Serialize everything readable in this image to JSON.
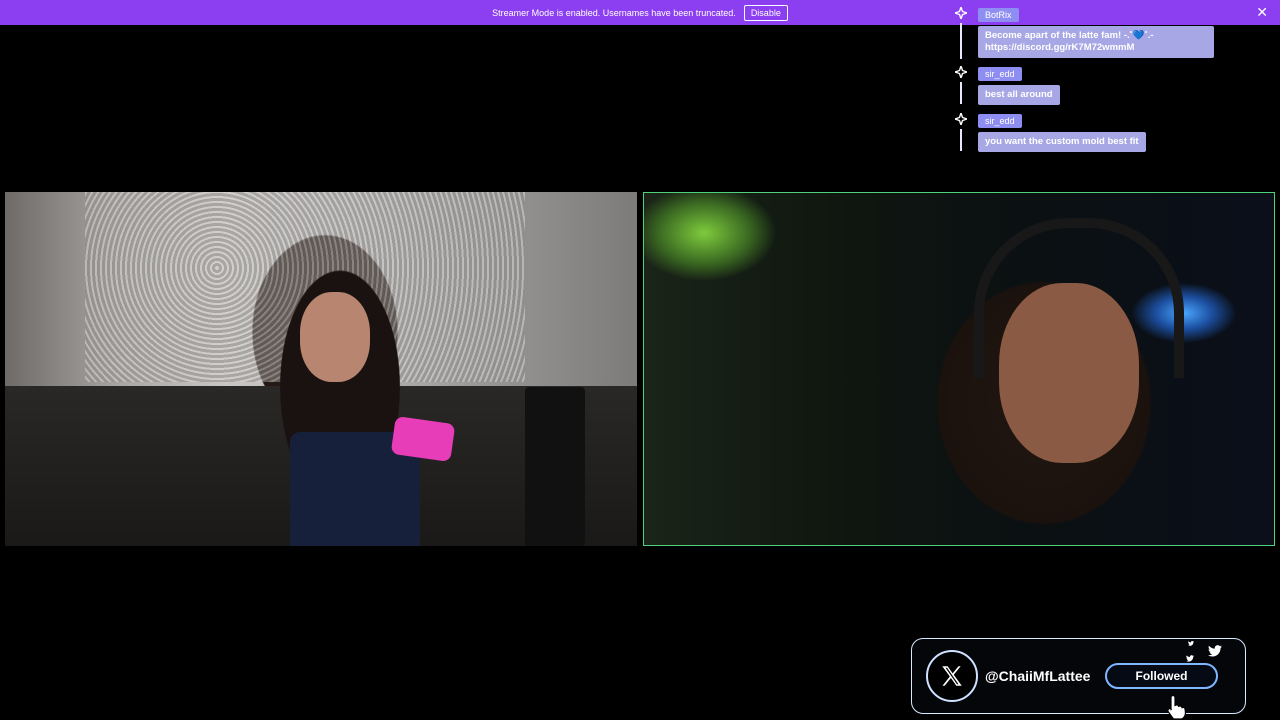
{
  "banner": {
    "message": "Streamer Mode is enabled. Usernames have been truncated.",
    "disable_label": "Disable",
    "close_label": "✕"
  },
  "chat": {
    "messages": [
      {
        "user": "BotRix",
        "text": "Become apart of the latte fam! -.˚💙˚.- https://discord.gg/rK7M72wmmM"
      },
      {
        "user": "sir_edd",
        "text": "best all around"
      },
      {
        "user": "sir_edd",
        "text": "you want the custom mold best fit"
      }
    ]
  },
  "follow_widget": {
    "logo_icon": "x-logo-icon",
    "handle": "@ChaiiMfLattee",
    "button_label": "Followed",
    "bird_icon": "twitter-bird-icon"
  },
  "colors": {
    "banner": "#8c3ff0",
    "chat_name_bg": "#8e8ef2",
    "chat_text_bg": "#a8a7e6",
    "right_cam_border": "#4fd07a",
    "follow_border": "#7fb6ff"
  }
}
